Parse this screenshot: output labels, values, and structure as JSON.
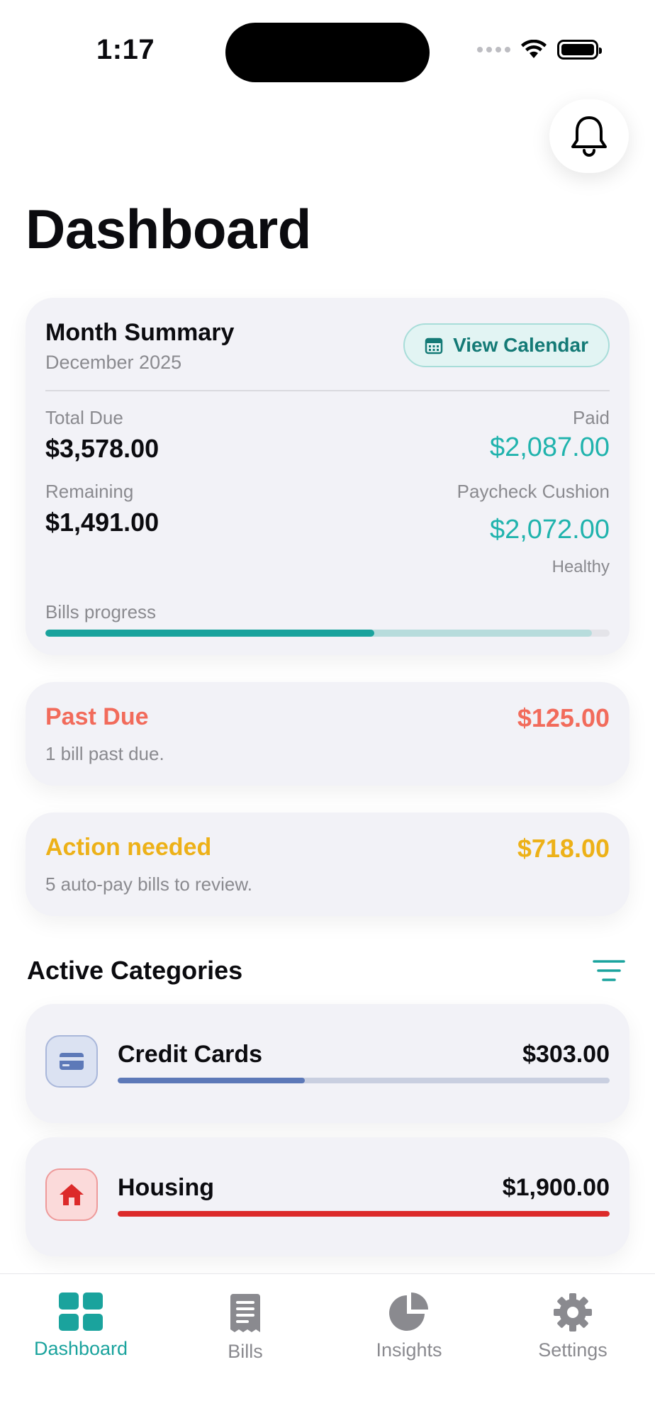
{
  "status_bar": {
    "time": "1:17"
  },
  "header": {
    "title": "Dashboard"
  },
  "summary": {
    "title": "Month Summary",
    "subtitle": "December 2025",
    "calendar_button": "View Calendar",
    "total_due_label": "Total Due",
    "total_due": "$3,578.00",
    "paid_label": "Paid",
    "paid": "$2,087.00",
    "remaining_label": "Remaining",
    "remaining": "$1,491.00",
    "cushion_label": "Paycheck Cushion",
    "cushion": "$2,072.00",
    "cushion_status": "Healthy",
    "progress_label": "Bills progress",
    "progress_paid_fraction": 0.583,
    "progress_secondary_fraction": 0.968
  },
  "alerts": [
    {
      "title": "Past Due",
      "amount": "$125.00",
      "subtitle": "1 bill past due.",
      "color": "#f26b5b"
    },
    {
      "title": "Action needed",
      "amount": "$718.00",
      "subtitle": "5 auto-pay bills to review.",
      "color": "#edb118"
    }
  ],
  "categories_section": {
    "title": "Active Categories"
  },
  "categories": [
    {
      "name": "Credit Cards",
      "amount": "$303.00",
      "icon": "credit-card-icon",
      "progress": 0.38,
      "color": "#5d79b8",
      "track": "#c9cfe0",
      "icon_bg": "#dbe2f2",
      "icon_border": "#a9b7da"
    },
    {
      "name": "Housing",
      "amount": "$1,900.00",
      "icon": "house-icon",
      "progress": 1.0,
      "color": "#dc2a2a",
      "track": "#f2b7b7",
      "icon_bg": "#fbdada",
      "icon_border": "#ee9a9a"
    }
  ],
  "tabs": [
    {
      "label": "Dashboard",
      "icon": "dashboard-grid-icon",
      "active": true
    },
    {
      "label": "Bills",
      "icon": "receipt-icon",
      "active": false
    },
    {
      "label": "Insights",
      "icon": "pie-chart-icon",
      "active": false
    },
    {
      "label": "Settings",
      "icon": "gear-icon",
      "active": false
    }
  ],
  "colors": {
    "accent": "#1aa39d",
    "paid_text": "#20b3ad"
  }
}
